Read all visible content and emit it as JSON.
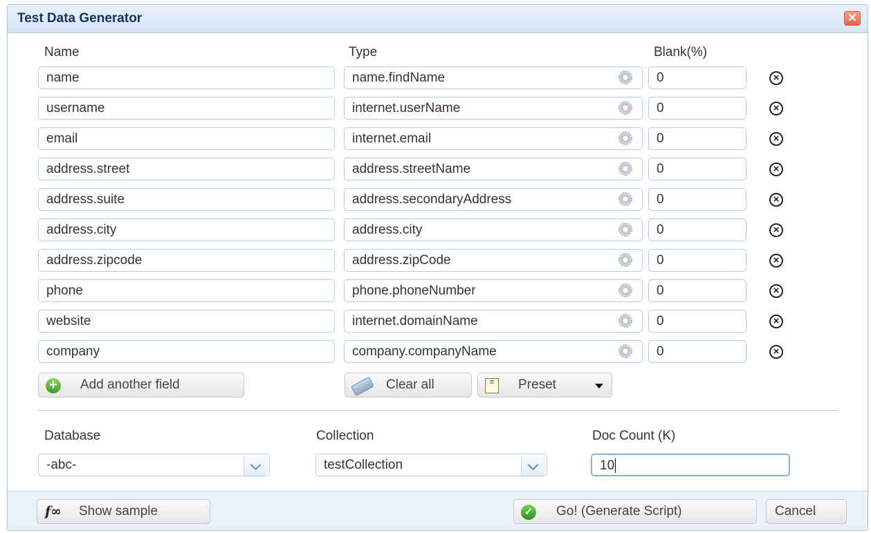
{
  "dialog": {
    "title": "Test Data Generator",
    "close_icon": "close-icon"
  },
  "columns": {
    "name": "Name",
    "type": "Type",
    "blank": "Blank(%)"
  },
  "rows": [
    {
      "name": "name",
      "type": "name.findName",
      "blank": "0"
    },
    {
      "name": "username",
      "type": "internet.userName",
      "blank": "0"
    },
    {
      "name": "email",
      "type": "internet.email",
      "blank": "0"
    },
    {
      "name": "address.street",
      "type": "address.streetName",
      "blank": "0"
    },
    {
      "name": "address.suite",
      "type": "address.secondaryAddress",
      "blank": "0"
    },
    {
      "name": "address.city",
      "type": "address.city",
      "blank": "0"
    },
    {
      "name": "address.zipcode",
      "type": "address.zipCode",
      "blank": "0"
    },
    {
      "name": "phone",
      "type": "phone.phoneNumber",
      "blank": "0"
    },
    {
      "name": "website",
      "type": "internet.domainName",
      "blank": "0"
    },
    {
      "name": "company",
      "type": "company.companyName",
      "blank": "0"
    }
  ],
  "buttons": {
    "add_field": "Add another field",
    "clear_all": "Clear all",
    "preset": "Preset",
    "show_sample": "Show sample",
    "go": "Go! (Generate Script)",
    "cancel": "Cancel"
  },
  "settings": {
    "database_label": "Database",
    "database_value": "-abc-",
    "collection_label": "Collection",
    "collection_value": "testCollection",
    "doc_count_label": "Doc Count (K)",
    "doc_count_value": "10"
  },
  "colors": {
    "accent": "#5b8fc7",
    "title_text": "#15325c",
    "close_button": "#e0684a",
    "go_icon": "#2f8e1b"
  }
}
